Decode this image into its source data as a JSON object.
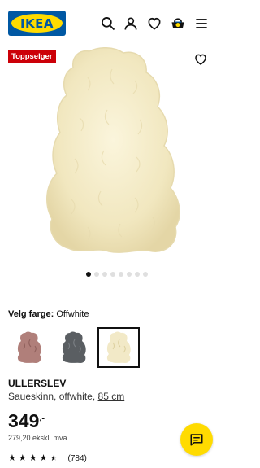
{
  "header": {
    "logo_text": "IKEA",
    "icons": [
      "search-icon",
      "profile-icon",
      "heart-icon",
      "cart-icon",
      "menu-icon"
    ],
    "brand_blue": "#0058A3",
    "brand_yellow": "#FFDB00"
  },
  "badge": {
    "label": "Toppselger",
    "color": "#CC0008"
  },
  "gallery": {
    "image_count": 8,
    "active_index": 0
  },
  "color_selector": {
    "label": "Velg farge:",
    "selected_value": "Offwhite",
    "options": [
      {
        "name": "pink",
        "color": "#B07F7A"
      },
      {
        "name": "grey",
        "color": "#5A5E62"
      },
      {
        "name": "offwhite",
        "color": "#F2E9C7"
      }
    ]
  },
  "product": {
    "name": "ULLERSLEV",
    "description": "Saueskinn, offwhite,",
    "size": "85 cm",
    "price_integer": "349",
    "price_decimal": ",-",
    "price_ex_vat": "279,20 ekskl. mva",
    "rating": 4.5,
    "review_count": "(784)"
  },
  "chat": {
    "icon": "chat-icon"
  }
}
